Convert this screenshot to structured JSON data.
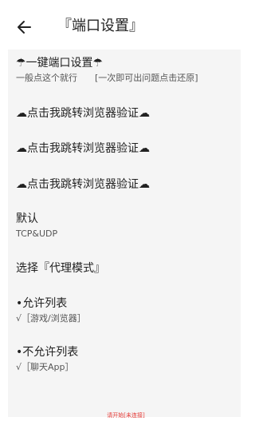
{
  "header": {
    "title": "『端口设置』"
  },
  "items": {
    "one_click": {
      "title": "☂一键端口设置☂",
      "subtitle_left": "一般点这个就行",
      "subtitle_right": "[一次即可出问题点击还原]"
    },
    "verify_1": "☁点击我跳转浏览器验证☁",
    "verify_2": "☁点击我跳转浏览器验证☁",
    "verify_3": "☁点击我跳转浏览器验证☁",
    "default_mode": {
      "title": "默认",
      "subtitle": "TCP&UDP"
    },
    "proxy_mode": "选择『代理模式』",
    "allow_list": {
      "title": "•允许列表",
      "subtitle": "√［游戏/浏览器］"
    },
    "deny_list": {
      "title": "•不允许列表",
      "subtitle": "√［聊天App］"
    }
  },
  "footer": {
    "status": "请开始[未连接]"
  },
  "colors": {
    "panel": "#f5f5f5",
    "text": "#222222",
    "secondary_text": "#555555",
    "status": "#e53935"
  }
}
